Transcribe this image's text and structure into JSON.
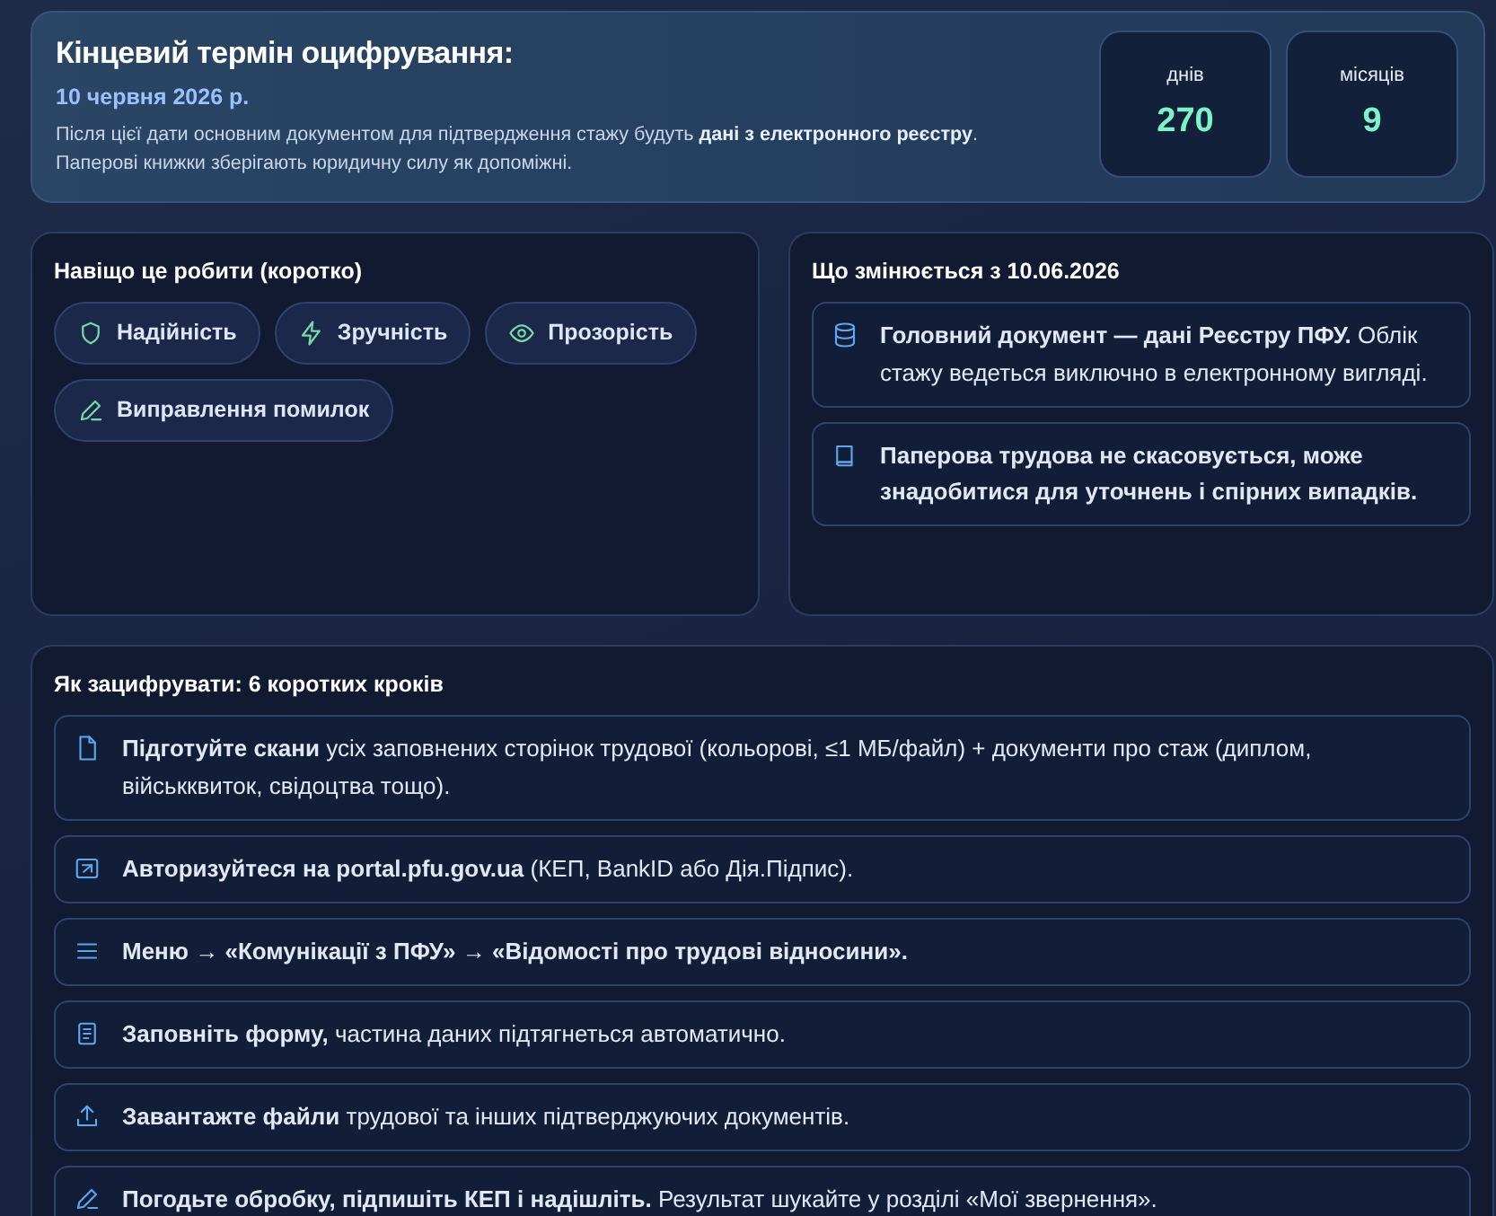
{
  "hero": {
    "title": "Кінцевий термін оцифрування:",
    "date": "10 червня 2026 р.",
    "description": "Після цієї дати основним документом для підтвердження стажу будуть **дані з електронного реєстру**.",
    "note": "Паперові книжки зберігають юридичну силу як допоміжні.",
    "stats": [
      {
        "label": "днів",
        "value": "270"
      },
      {
        "label": "місяців",
        "value": "9"
      }
    ]
  },
  "why": {
    "title": "Навіщо це робити (коротко)",
    "chips": [
      {
        "kind": "shield",
        "label": "Надійність"
      },
      {
        "kind": "bolt",
        "label": "Зручність"
      },
      {
        "kind": "eye",
        "label": "Прозорість"
      },
      {
        "kind": "pencil",
        "label": "Виправлення помилок"
      }
    ]
  },
  "changes": {
    "title": "Що змінюється з 10.06.2026",
    "items": [
      {
        "kind": "database",
        "text": "**Головний документ — дані Реєстру ПФУ.** Облік стажу ведеться виключно в електронному вигляді."
      },
      {
        "kind": "book",
        "text": "**Паперова трудова не скасовується, може знадобитися для уточнень і спірних випадків.**"
      }
    ]
  },
  "steps": {
    "title": "Як зацифрувати: 6 коротких кроків",
    "items": [
      {
        "kind": "file",
        "text": "**Підготуйте скани** усіх заповнених сторінок трудової (кольорові, ≤1 МБ/файл) + документи про стаж (диплом, військквиток, свідоцтва тощо)."
      },
      {
        "kind": "login",
        "text": "**Авторизуйтеся на portal.pfu.gov.ua** (КЕП, BankID або Дія.Підпис)."
      },
      {
        "kind": "menu",
        "text": "**Меню → «Комунікації з ПФУ» → «Відомості про трудові відносини».**"
      },
      {
        "kind": "form",
        "text": "**Заповніть форму,** частина даних підтягнеться автоматично."
      },
      {
        "kind": "upload",
        "text": "**Завантажте файли** трудової та інших підтверджуючих документів."
      },
      {
        "kind": "pencil",
        "text": "**Погодьте обробку, підпишіть КЕП і надішліть.** Результат шукайте у розділі «Мої звернення»."
      }
    ]
  }
}
